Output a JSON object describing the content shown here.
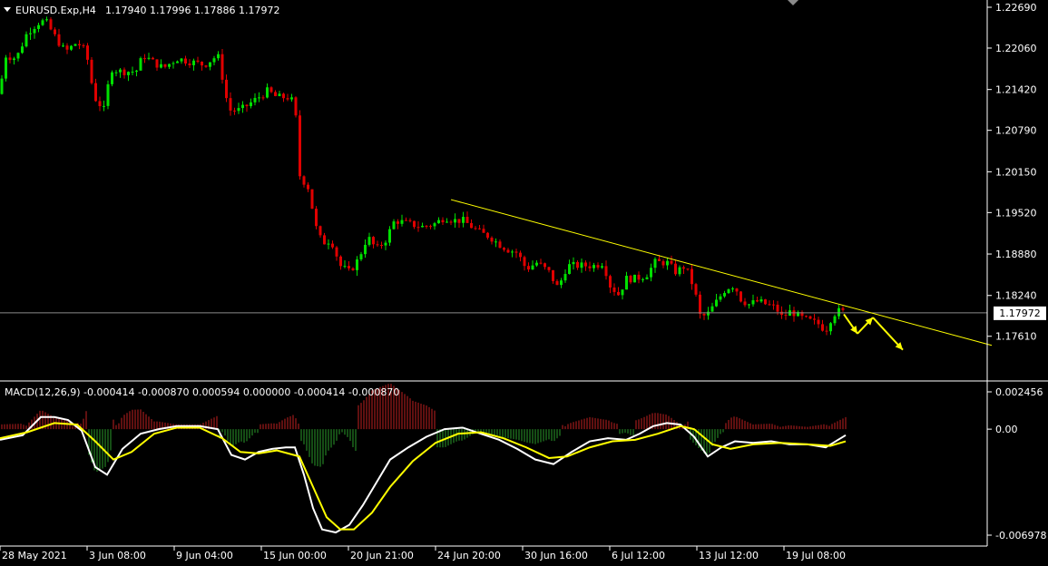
{
  "header": {
    "symbol": "EURUSD.Exp,H4",
    "ohlc": "1.17940 1.17996 1.17886 1.17972"
  },
  "macd_header": "MACD(12,26,9) -0.000414 -0.000870 0.000594 0.000000 -0.000414 -0.000870",
  "current_price_label": "1.17972",
  "colors": {
    "background": "#000000",
    "bull": "#00e000",
    "bear": "#e00000",
    "trendline": "#ffff00",
    "macd_line": "#ffffff",
    "signal_line": "#ffff00",
    "hist_pos": "#c02020",
    "hist_neg": "#2a9a2a",
    "grid_text": "#ffffff"
  },
  "chart_data": [
    {
      "type": "candlestick",
      "title": "EURUSD.Exp,H4",
      "ylim": [
        1.172,
        1.2269
      ],
      "y_ticks": [
        "1.22690",
        "1.22060",
        "1.21420",
        "1.20790",
        "1.20150",
        "1.19520",
        "1.18880",
        "1.18240",
        "1.17610"
      ],
      "x_ticks": [
        "28 May 2021",
        "3 Jun 08:00",
        "9 Jun 04:00",
        "15 Jun 00:00",
        "20 Jun 21:00",
        "24 Jun 20:00",
        "30 Jun 16:00",
        "6 Jul 12:00",
        "13 Jul 12:00",
        "19 Jul 08:00"
      ],
      "close_path": [
        [
          0,
          1.2135
        ],
        [
          5,
          1.2195
        ],
        [
          18,
          1.219
        ],
        [
          30,
          1.223
        ],
        [
          42,
          1.2245
        ],
        [
          50,
          1.2248
        ],
        [
          60,
          1.2225
        ],
        [
          72,
          1.22
        ],
        [
          85,
          1.2215
        ],
        [
          95,
          1.22
        ],
        [
          100,
          1.216
        ],
        [
          104,
          1.213
        ],
        [
          115,
          1.211
        ],
        [
          122,
          1.2175
        ],
        [
          132,
          1.217
        ],
        [
          150,
          1.217
        ],
        [
          158,
          1.2195
        ],
        [
          168,
          1.2185
        ],
        [
          180,
          1.2175
        ],
        [
          195,
          1.219
        ],
        [
          210,
          1.2185
        ],
        [
          225,
          1.218
        ],
        [
          240,
          1.2195
        ],
        [
          246,
          1.2155
        ],
        [
          252,
          1.211
        ],
        [
          265,
          1.211
        ],
        [
          280,
          1.2125
        ],
        [
          295,
          1.214
        ],
        [
          305,
          1.213
        ],
        [
          318,
          1.213
        ],
        [
          325,
          1.212
        ],
        [
          330,
          1.201
        ],
        [
          340,
          1.199
        ],
        [
          348,
          1.193
        ],
        [
          355,
          1.1905
        ],
        [
          365,
          1.191
        ],
        [
          375,
          1.187
        ],
        [
          385,
          1.186
        ],
        [
          395,
          1.188
        ],
        [
          405,
          1.1915
        ],
        [
          415,
          1.1895
        ],
        [
          425,
          1.191
        ],
        [
          435,
          1.194
        ],
        [
          450,
          1.1935
        ],
        [
          465,
          1.193
        ],
        [
          480,
          1.1935
        ],
        [
          490,
          1.1945
        ],
        [
          500,
          1.194
        ],
        [
          510,
          1.194
        ],
        [
          520,
          1.193
        ],
        [
          530,
          1.192
        ],
        [
          540,
          1.1915
        ],
        [
          548,
          1.1905
        ],
        [
          560,
          1.1895
        ],
        [
          570,
          1.189
        ],
        [
          580,
          1.1865
        ],
        [
          592,
          1.1875
        ],
        [
          605,
          1.186
        ],
        [
          615,
          1.1835
        ],
        [
          625,
          1.187
        ],
        [
          640,
          1.187
        ],
        [
          655,
          1.187
        ],
        [
          665,
          1.1875
        ],
        [
          672,
          1.184
        ],
        [
          682,
          1.1825
        ],
        [
          690,
          1.185
        ],
        [
          700,
          1.185
        ],
        [
          712,
          1.1855
        ],
        [
          722,
          1.1875
        ],
        [
          735,
          1.1875
        ],
        [
          745,
          1.186
        ],
        [
          755,
          1.187
        ],
        [
          765,
          1.1835
        ],
        [
          772,
          1.179
        ],
        [
          780,
          1.1795
        ],
        [
          790,
          1.1815
        ],
        [
          800,
          1.1835
        ],
        [
          810,
          1.184
        ],
        [
          815,
          1.182
        ],
        [
          825,
          1.181
        ],
        [
          835,
          1.1815
        ],
        [
          845,
          1.181
        ],
        [
          855,
          1.1805
        ],
        [
          862,
          1.179
        ],
        [
          872,
          1.18
        ],
        [
          882,
          1.179
        ],
        [
          892,
          1.1785
        ],
        [
          902,
          1.178
        ],
        [
          910,
          1.177
        ],
        [
          918,
          1.1795
        ],
        [
          925,
          1.18
        ],
        [
          932,
          1.1797
        ]
      ],
      "trendline": {
        "from": [
          497,
          1.1972
        ],
        "to": [
          1093,
          1.1747
        ]
      },
      "current_price": 1.17972,
      "arrows": [
        {
          "from": [
            930,
            1.1795
          ],
          "to": [
            945,
            1.1765
          ]
        },
        {
          "from": [
            945,
            1.1765
          ],
          "to": [
            962,
            1.179
          ]
        },
        {
          "from": [
            962,
            1.179
          ],
          "to": [
            995,
            1.174
          ]
        }
      ]
    },
    {
      "type": "line",
      "title": "MACD(12,26,9)",
      "ylim": [
        -0.006978,
        0.002456
      ],
      "y_ticks": [
        "0.002456",
        "0.00",
        "-0.006978"
      ],
      "series": [
        {
          "name": "MACD",
          "points": [
            [
              0,
              -0.0007
            ],
            [
              25,
              -0.0004
            ],
            [
              45,
              0.0008
            ],
            [
              60,
              0.0008
            ],
            [
              75,
              0.0006
            ],
            [
              90,
              -0.0001
            ],
            [
              105,
              -0.0025
            ],
            [
              118,
              -0.003
            ],
            [
              135,
              -0.0013
            ],
            [
              155,
              -0.0003
            ],
            [
              175,
              0.0
            ],
            [
              195,
              0.0002
            ],
            [
              220,
              0.0002
            ],
            [
              240,
              0.0
            ],
            [
              255,
              -0.0017
            ],
            [
              270,
              -0.002
            ],
            [
              285,
              -0.0015
            ],
            [
              300,
              -0.0013
            ],
            [
              315,
              -0.0012
            ],
            [
              325,
              -0.0012
            ],
            [
              335,
              -0.003
            ],
            [
              345,
              -0.0052
            ],
            [
              355,
              -0.0066
            ],
            [
              370,
              -0.0068
            ],
            [
              385,
              -0.0063
            ],
            [
              400,
              -0.005
            ],
            [
              415,
              -0.0035
            ],
            [
              430,
              -0.002
            ],
            [
              450,
              -0.0012
            ],
            [
              470,
              -0.0005
            ],
            [
              490,
              0.0
            ],
            [
              510,
              0.0001
            ],
            [
              530,
              -0.0003
            ],
            [
              550,
              -0.0007
            ],
            [
              570,
              -0.0013
            ],
            [
              590,
              -0.002
            ],
            [
              610,
              -0.0023
            ],
            [
              630,
              -0.0015
            ],
            [
              650,
              -0.0008
            ],
            [
              670,
              -0.0006
            ],
            [
              690,
              -0.0007
            ],
            [
              705,
              -0.0003
            ],
            [
              720,
              0.0002
            ],
            [
              735,
              0.0004
            ],
            [
              750,
              0.0003
            ],
            [
              765,
              -0.0005
            ],
            [
              780,
              -0.0018
            ],
            [
              795,
              -0.0012
            ],
            [
              810,
              -0.0008
            ],
            [
              830,
              -0.0009
            ],
            [
              850,
              -0.0008
            ],
            [
              870,
              -0.001
            ],
            [
              890,
              -0.001
            ],
            [
              910,
              -0.0012
            ],
            [
              932,
              -0.0004
            ]
          ]
        },
        {
          "name": "Signal",
          "points": [
            [
              0,
              -0.0006
            ],
            [
              30,
              -0.0002
            ],
            [
              60,
              0.0004
            ],
            [
              85,
              0.0003
            ],
            [
              105,
              -0.0008
            ],
            [
              125,
              -0.002
            ],
            [
              145,
              -0.0015
            ],
            [
              170,
              -0.0003
            ],
            [
              195,
              0.0001
            ],
            [
              220,
              0.0001
            ],
            [
              245,
              -0.0006
            ],
            [
              265,
              -0.0015
            ],
            [
              285,
              -0.0016
            ],
            [
              305,
              -0.0014
            ],
            [
              330,
              -0.0018
            ],
            [
              345,
              -0.0038
            ],
            [
              360,
              -0.0058
            ],
            [
              375,
              -0.0066
            ],
            [
              390,
              -0.0066
            ],
            [
              410,
              -0.0055
            ],
            [
              430,
              -0.0038
            ],
            [
              455,
              -0.0021
            ],
            [
              480,
              -0.0009
            ],
            [
              505,
              -0.0003
            ],
            [
              530,
              -0.0002
            ],
            [
              555,
              -0.0006
            ],
            [
              580,
              -0.0012
            ],
            [
              605,
              -0.0019
            ],
            [
              625,
              -0.0018
            ],
            [
              650,
              -0.0012
            ],
            [
              675,
              -0.0008
            ],
            [
              700,
              -0.0007
            ],
            [
              725,
              -0.0003
            ],
            [
              750,
              0.0002
            ],
            [
              765,
              0.0
            ],
            [
              785,
              -0.001
            ],
            [
              805,
              -0.0013
            ],
            [
              830,
              -0.001
            ],
            [
              860,
              -0.0009
            ],
            [
              890,
              -0.001
            ],
            [
              915,
              -0.0011
            ],
            [
              932,
              -0.0008
            ]
          ]
        }
      ],
      "histogram_positive_ranges": [
        [
          0,
          95
        ],
        [
          125,
          240
        ],
        [
          285,
          330
        ],
        [
          395,
          480
        ],
        [
          620,
          680
        ],
        [
          700,
          760
        ],
        [
          800,
          935
        ]
      ],
      "histogram_negative_ranges": [
        [
          100,
          120
        ],
        [
          245,
          280
        ],
        [
          335,
          390
        ],
        [
          485,
          615
        ],
        [
          685,
          695
        ],
        [
          765,
          795
        ]
      ]
    }
  ]
}
